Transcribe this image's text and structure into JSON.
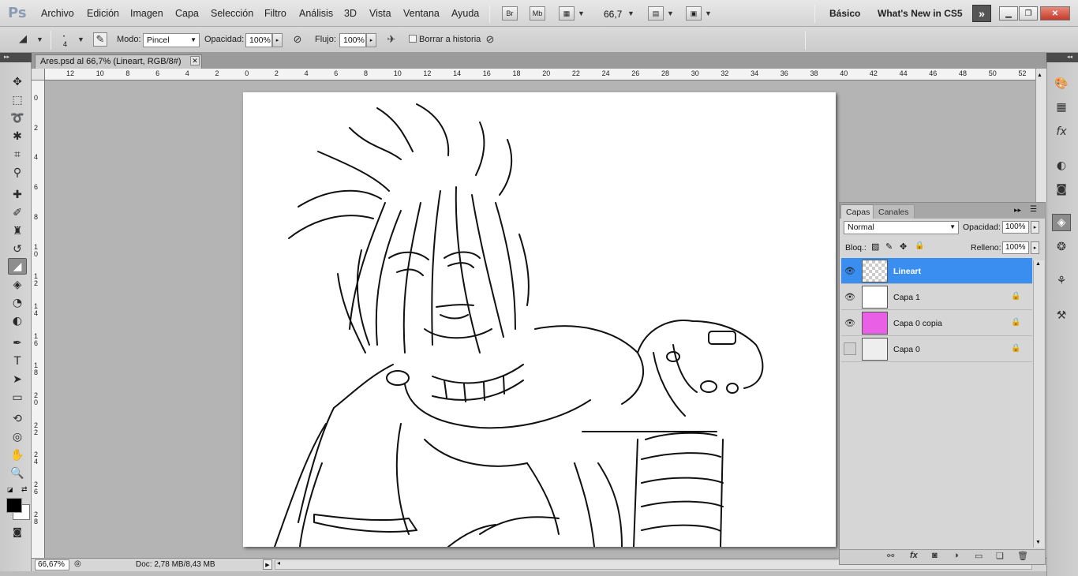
{
  "app": {
    "logo": "Ps"
  },
  "menu": [
    "Archivo",
    "Edición",
    "Imagen",
    "Capa",
    "Selección",
    "Filtro",
    "Análisis",
    "3D",
    "Vista",
    "Ventana",
    "Ayuda"
  ],
  "menubar_buttons": {
    "bridge": "Br",
    "mini_bridge": "Mb",
    "zoom": "66,7"
  },
  "workspaces": {
    "basic": "Básico",
    "whats_new": "What's New in CS5",
    "more": "»"
  },
  "options": {
    "brush_size": "4",
    "mode_label": "Modo:",
    "mode_value": "Pincel",
    "opacity_label": "Opacidad:",
    "opacity_value": "100%",
    "flow_label": "Flujo:",
    "flow_value": "100%",
    "erase_history_label": "Borrar a historia"
  },
  "document": {
    "tab_title": "Ares.psd al 66,7% (Lineart, RGB/8#)",
    "zoom": "66,67%",
    "doc_info": "Doc: 2,78 MB/8,43 MB"
  },
  "ruler": {
    "h_labels": [
      "12",
      "10",
      "8",
      "6",
      "4",
      "2",
      "0",
      "2",
      "4",
      "6",
      "8",
      "10",
      "12",
      "14",
      "16",
      "18",
      "20",
      "22",
      "24",
      "26",
      "28",
      "30",
      "32",
      "34",
      "36",
      "38",
      "40",
      "42",
      "44",
      "46",
      "48",
      "50",
      "52"
    ],
    "v_labels": [
      "0",
      "2",
      "4",
      "6",
      "8",
      "1 0",
      "1 2",
      "1 4",
      "1 6",
      "1 8",
      "2 0",
      "2 2",
      "2 4",
      "2 6",
      "2 8"
    ]
  },
  "layers_panel": {
    "tabs": [
      "Capas",
      "Canales"
    ],
    "blend_mode": "Normal",
    "opacity_label": "Opacidad:",
    "opacity_value": "100%",
    "lock_label": "Bloq.:",
    "fill_label": "Relleno:",
    "fill_value": "100%",
    "layers": [
      {
        "name": "Lineart",
        "visible": true,
        "selected": true,
        "locked": false
      },
      {
        "name": "Capa 1",
        "visible": true,
        "selected": false,
        "locked": true
      },
      {
        "name": "Capa 0 copia",
        "visible": true,
        "selected": false,
        "locked": true
      },
      {
        "name": "Capa 0",
        "visible": false,
        "selected": false,
        "locked": true
      }
    ]
  },
  "colors": {
    "selection": "#3a8ef0",
    "foreground": "#000000",
    "background": "#ffffff",
    "magenta_thumb": "#e95fe6"
  }
}
